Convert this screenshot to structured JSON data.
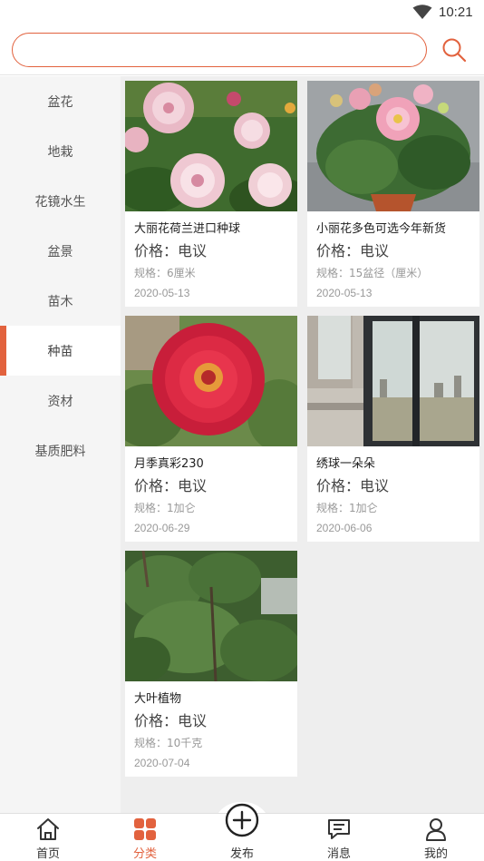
{
  "status_bar": {
    "time": "10:21"
  },
  "search": {
    "placeholder": "",
    "value": ""
  },
  "sidebar": {
    "items": [
      {
        "label": "盆花"
      },
      {
        "label": "地栽"
      },
      {
        "label": "花镜水生"
      },
      {
        "label": "盆景"
      },
      {
        "label": "苗木"
      },
      {
        "label": "种苗"
      },
      {
        "label": "资材"
      },
      {
        "label": "基质肥料"
      }
    ],
    "active_index": 5
  },
  "products": [
    {
      "name": "大丽花荷兰进口种球",
      "price": "价格：电议",
      "spec": "规格：6厘米",
      "date": "2020-05-13",
      "image": "dahlia-white-pink"
    },
    {
      "name": "小丽花多色可选今年新货",
      "price": "价格：电议",
      "spec": "规格：15盆径（厘米）",
      "date": "2020-05-13",
      "image": "dahlia-pink-pot"
    },
    {
      "name": "月季真彩230",
      "price": "价格：电议",
      "spec": "规格：1加仑",
      "date": "2020-06-29",
      "image": "red-rose"
    },
    {
      "name": "绣球一朵朵",
      "price": "价格：电议",
      "spec": "规格：1加仑",
      "date": "2020-06-06",
      "image": "window-view"
    },
    {
      "name": "大叶植物",
      "price": "价格：电议",
      "spec": "规格：10千克",
      "date": "2020-07-04",
      "image": "green-plant"
    }
  ],
  "tabbar": {
    "items": [
      {
        "label": "首页",
        "icon": "home-icon"
      },
      {
        "label": "分类",
        "icon": "category-icon"
      },
      {
        "label": "发布",
        "icon": "publish-plus-icon"
      },
      {
        "label": "消息",
        "icon": "message-icon"
      },
      {
        "label": "我的",
        "icon": "profile-icon"
      }
    ],
    "active_index": 1
  },
  "colors": {
    "accent": "#e2623e",
    "sidebar_bg": "#f5f5f5",
    "main_bg": "#eeeeee"
  }
}
